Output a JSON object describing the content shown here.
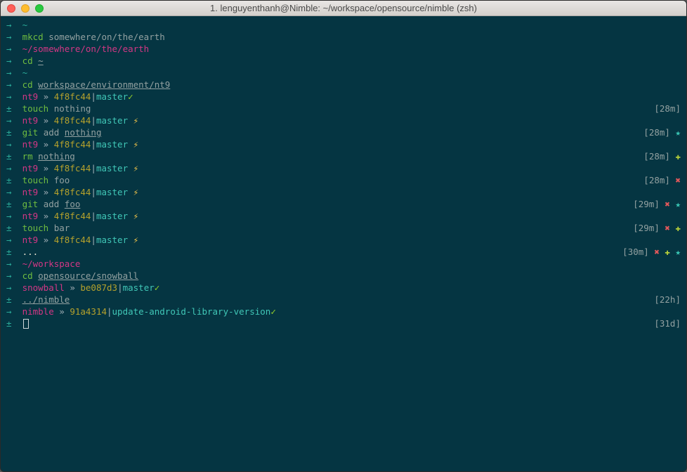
{
  "window": {
    "title": "1. lenguyenthanh@Nimble: ~/workspace/opensource/nimble (zsh)"
  },
  "glyph": {
    "arrow": "→",
    "plus": "±",
    "bolt": "⚡︎",
    "check": "✓",
    "star": "★",
    "cross": "✖",
    "plusmark": "✚",
    "dots": "..."
  },
  "lines": [
    {
      "type": "arrow",
      "segs": [
        {
          "t": "~",
          "c": "c-cyan"
        }
      ]
    },
    {
      "type": "arrow",
      "segs": [
        {
          "t": "mkcd ",
          "c": "c-green"
        },
        {
          "t": "somewhere/on/the/earth",
          "c": "c-grey"
        }
      ]
    },
    {
      "type": "arrow",
      "segs": [
        {
          "t": "~/somewhere/on/the/earth",
          "c": "c-magenta"
        }
      ]
    },
    {
      "type": "arrow",
      "segs": [
        {
          "t": "cd ",
          "c": "c-green"
        },
        {
          "t": "~",
          "c": "c-grey",
          "u": true
        }
      ]
    },
    {
      "type": "arrow",
      "segs": [
        {
          "t": "~",
          "c": "c-cyan"
        }
      ]
    },
    {
      "type": "arrow",
      "segs": [
        {
          "t": "cd ",
          "c": "c-green"
        },
        {
          "t": "workspace/environment/nt9",
          "c": "c-grey",
          "u": true
        }
      ]
    },
    {
      "type": "arrow",
      "segs": [
        {
          "t": "nt9",
          "c": "c-magenta"
        },
        {
          "t": " » ",
          "c": "c-grey2"
        },
        {
          "t": "4f8fc44",
          "c": "c-olive"
        },
        {
          "t": "|",
          "c": "c-grey2"
        },
        {
          "t": "master",
          "c": "c-cyan2"
        },
        {
          "t": "✓",
          "c": "c-greenb"
        }
      ]
    },
    {
      "type": "plus",
      "segs": [
        {
          "t": "touch ",
          "c": "c-green"
        },
        {
          "t": "nothing",
          "c": "c-grey"
        }
      ],
      "right": {
        "time": "[28m]",
        "marks": []
      }
    },
    {
      "type": "arrow",
      "segs": [
        {
          "t": "nt9",
          "c": "c-magenta"
        },
        {
          "t": " » ",
          "c": "c-grey2"
        },
        {
          "t": "4f8fc44",
          "c": "c-olive"
        },
        {
          "t": "|",
          "c": "c-grey2"
        },
        {
          "t": "master",
          "c": "c-cyan2"
        },
        {
          "t": " ",
          "c": ""
        },
        {
          "t": "⚡︎",
          "c": "bolt"
        }
      ]
    },
    {
      "type": "plus",
      "segs": [
        {
          "t": "git ",
          "c": "c-green"
        },
        {
          "t": "add ",
          "c": "c-grey"
        },
        {
          "t": "nothing",
          "c": "c-grey",
          "u": true
        }
      ],
      "right": {
        "time": "[28m]",
        "marks": [
          {
            "g": "star",
            "c": "c-star"
          }
        ]
      }
    },
    {
      "type": "arrow",
      "segs": [
        {
          "t": "nt9",
          "c": "c-magenta"
        },
        {
          "t": " » ",
          "c": "c-grey2"
        },
        {
          "t": "4f8fc44",
          "c": "c-olive"
        },
        {
          "t": "|",
          "c": "c-grey2"
        },
        {
          "t": "master",
          "c": "c-cyan2"
        },
        {
          "t": " ",
          "c": ""
        },
        {
          "t": "⚡︎",
          "c": "bolt"
        }
      ]
    },
    {
      "type": "plus",
      "segs": [
        {
          "t": "rm ",
          "c": "c-green"
        },
        {
          "t": "nothing",
          "c": "c-grey",
          "u": true
        }
      ],
      "right": {
        "time": "[28m]",
        "marks": [
          {
            "g": "plusmark",
            "c": "c-plus"
          }
        ]
      }
    },
    {
      "type": "arrow",
      "segs": [
        {
          "t": "nt9",
          "c": "c-magenta"
        },
        {
          "t": " » ",
          "c": "c-grey2"
        },
        {
          "t": "4f8fc44",
          "c": "c-olive"
        },
        {
          "t": "|",
          "c": "c-grey2"
        },
        {
          "t": "master",
          "c": "c-cyan2"
        },
        {
          "t": " ",
          "c": ""
        },
        {
          "t": "⚡︎",
          "c": "bolt"
        }
      ]
    },
    {
      "type": "plus",
      "segs": [
        {
          "t": "touch ",
          "c": "c-green"
        },
        {
          "t": "foo",
          "c": "c-grey"
        }
      ],
      "right": {
        "time": "[28m]",
        "marks": [
          {
            "g": "cross",
            "c": "c-x"
          }
        ]
      }
    },
    {
      "type": "arrow",
      "segs": [
        {
          "t": "nt9",
          "c": "c-magenta"
        },
        {
          "t": " » ",
          "c": "c-grey2"
        },
        {
          "t": "4f8fc44",
          "c": "c-olive"
        },
        {
          "t": "|",
          "c": "c-grey2"
        },
        {
          "t": "master",
          "c": "c-cyan2"
        },
        {
          "t": " ",
          "c": ""
        },
        {
          "t": "⚡︎",
          "c": "bolt"
        }
      ]
    },
    {
      "type": "plus",
      "segs": [
        {
          "t": "git ",
          "c": "c-green"
        },
        {
          "t": "add ",
          "c": "c-grey"
        },
        {
          "t": "foo",
          "c": "c-grey",
          "u": true
        }
      ],
      "right": {
        "time": "[29m]",
        "marks": [
          {
            "g": "cross",
            "c": "c-x"
          },
          {
            "g": "star",
            "c": "c-star"
          }
        ]
      }
    },
    {
      "type": "arrow",
      "segs": [
        {
          "t": "nt9",
          "c": "c-magenta"
        },
        {
          "t": " » ",
          "c": "c-grey2"
        },
        {
          "t": "4f8fc44",
          "c": "c-olive"
        },
        {
          "t": "|",
          "c": "c-grey2"
        },
        {
          "t": "master",
          "c": "c-cyan2"
        },
        {
          "t": " ",
          "c": ""
        },
        {
          "t": "⚡︎",
          "c": "bolt"
        }
      ]
    },
    {
      "type": "plus",
      "segs": [
        {
          "t": "touch ",
          "c": "c-green"
        },
        {
          "t": "bar",
          "c": "c-grey"
        }
      ],
      "right": {
        "time": "[29m]",
        "marks": [
          {
            "g": "cross",
            "c": "c-x"
          },
          {
            "g": "plusmark",
            "c": "c-plus"
          }
        ]
      }
    },
    {
      "type": "arrow",
      "segs": [
        {
          "t": "nt9",
          "c": "c-magenta"
        },
        {
          "t": " » ",
          "c": "c-grey2"
        },
        {
          "t": "4f8fc44",
          "c": "c-olive"
        },
        {
          "t": "|",
          "c": "c-grey2"
        },
        {
          "t": "master",
          "c": "c-cyan2"
        },
        {
          "t": " ",
          "c": ""
        },
        {
          "t": "⚡︎",
          "c": "bolt"
        }
      ]
    },
    {
      "type": "plus",
      "segs": [
        {
          "t": "...",
          "c": "c-cream"
        }
      ],
      "right": {
        "time": "[30m]",
        "marks": [
          {
            "g": "cross",
            "c": "c-x"
          },
          {
            "g": "plusmark",
            "c": "c-plus"
          },
          {
            "g": "star",
            "c": "c-star"
          }
        ]
      }
    },
    {
      "type": "arrow",
      "segs": [
        {
          "t": "~/workspace",
          "c": "c-magenta"
        }
      ]
    },
    {
      "type": "arrow",
      "segs": [
        {
          "t": "cd ",
          "c": "c-green"
        },
        {
          "t": "opensource/snowball",
          "c": "c-grey",
          "u": true
        }
      ]
    },
    {
      "type": "arrow",
      "segs": [
        {
          "t": "snowball",
          "c": "c-magenta"
        },
        {
          "t": " » ",
          "c": "c-grey2"
        },
        {
          "t": "be087d3",
          "c": "c-olive"
        },
        {
          "t": "|",
          "c": "c-grey2"
        },
        {
          "t": "master",
          "c": "c-cyan2"
        },
        {
          "t": "✓",
          "c": "c-greenb"
        }
      ]
    },
    {
      "type": "plus",
      "segs": [
        {
          "t": "../nimble",
          "c": "c-grey",
          "u": true
        }
      ],
      "right": {
        "time": "[22h]",
        "marks": []
      }
    },
    {
      "type": "arrow",
      "segs": [
        {
          "t": "nimble",
          "c": "c-magenta"
        },
        {
          "t": " » ",
          "c": "c-grey2"
        },
        {
          "t": "91a4314",
          "c": "c-olive"
        },
        {
          "t": "|",
          "c": "c-grey2"
        },
        {
          "t": "update-android-library-version",
          "c": "c-cyan2"
        },
        {
          "t": "✓",
          "c": "c-greenb"
        }
      ]
    },
    {
      "type": "plus",
      "segs": [
        {
          "t": "",
          "c": ""
        }
      ],
      "cursor": true,
      "right": {
        "time": "[31d]",
        "marks": []
      }
    }
  ]
}
